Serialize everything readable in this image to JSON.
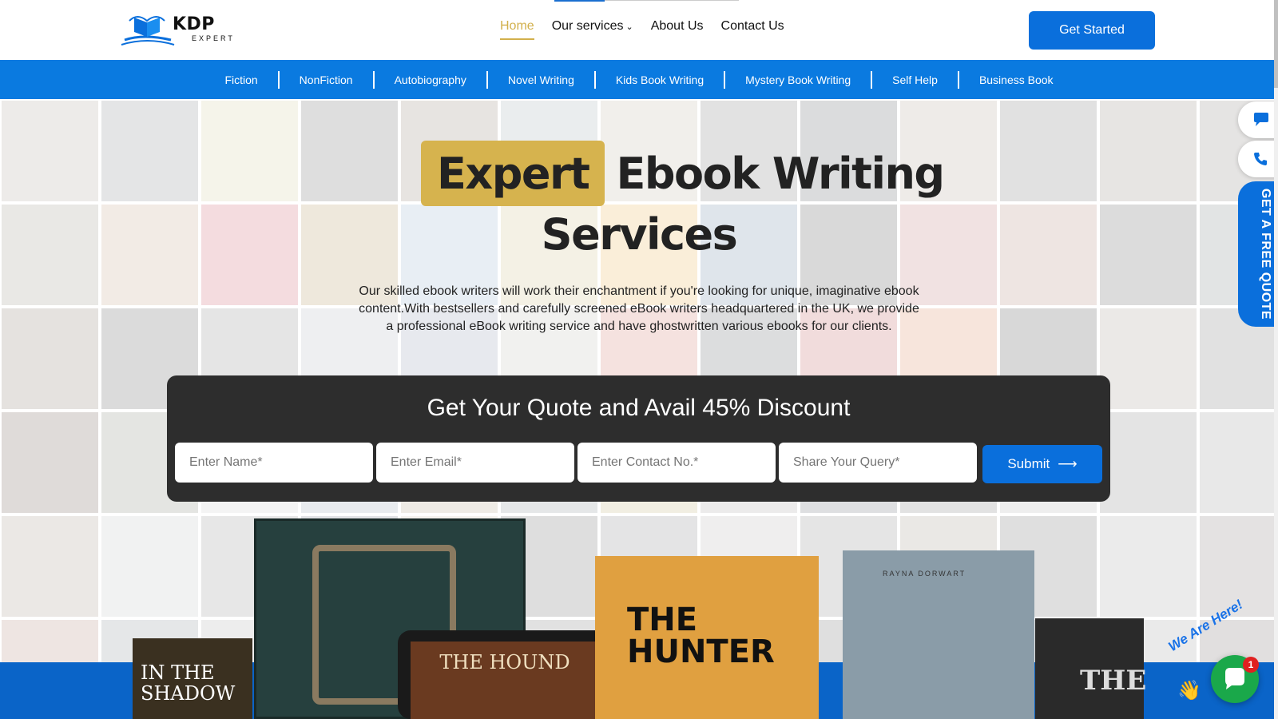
{
  "brand": {
    "logo_main": "KDP",
    "logo_sub": "EXPERT"
  },
  "nav": {
    "items": [
      {
        "label": "Home",
        "active": true
      },
      {
        "label": "Our services",
        "dropdown": true
      },
      {
        "label": "About Us"
      },
      {
        "label": "Contact Us"
      }
    ],
    "cta": "Get Started"
  },
  "categories": [
    "Fiction",
    "NonFiction",
    "Autobiography",
    "Novel Writing",
    "Kids Book Writing",
    "Mystery Book Writing",
    "Self Help",
    "Business Book"
  ],
  "hero": {
    "title_highlight": "Expert",
    "title_rest": "Ebook Writing",
    "title_line2": "Services",
    "description": "Our skilled ebook writers will work their enchantment if you're looking for unique, imaginative ebook content.With bestsellers and carefully screened eBook writers headquartered in the UK, we provide a professional eBook writing service and have ghostwritten various ebooks for our clients."
  },
  "quote_form": {
    "title": "Get Your Quote and Avail 45% Discount",
    "name_placeholder": "Enter Name*",
    "email_placeholder": "Enter Email*",
    "contact_placeholder": "Enter Contact No.*",
    "query_placeholder": "Share Your Query*",
    "submit_label": "Submit"
  },
  "books": {
    "shadow_title": "IN THE SHADOW",
    "hound_title": "THE HOUND",
    "hunter_title": "THE HUNTER",
    "dragon_author": "RAYNA DORWART",
    "last_title": "THE"
  },
  "side": {
    "free_quote": "GET A FREE QUOTE"
  },
  "chat": {
    "tagline": "We Are Here!",
    "badge_count": "1"
  },
  "colors": {
    "primary_blue": "#0a6fdc",
    "gold": "#d6b34e",
    "dark_panel": "#2d2d2d",
    "chat_green": "#1aa84a"
  }
}
